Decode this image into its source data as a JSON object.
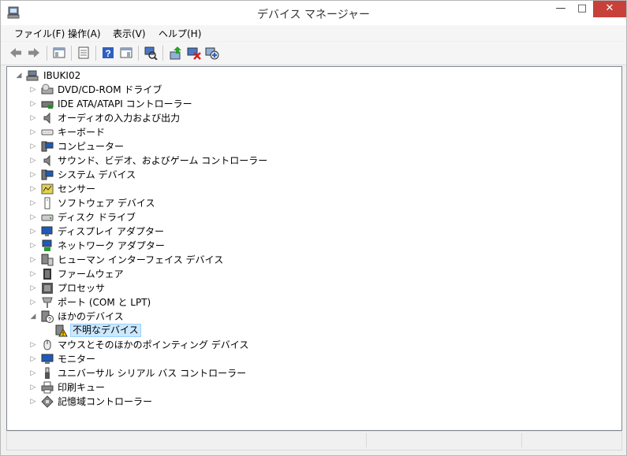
{
  "window": {
    "title": "デバイス マネージャー",
    "controls": {
      "minimize": "—",
      "maximize": "□",
      "close": "✕"
    }
  },
  "menu": [
    "ファイル(F)",
    "操作(A)",
    "表示(V)",
    "ヘルプ(H)"
  ],
  "toolbar": [
    {
      "name": "back-arrow-icon"
    },
    {
      "name": "forward-arrow-icon"
    },
    {
      "name": "show-hide-tree-icon"
    },
    {
      "name": "properties-icon"
    },
    {
      "name": "help-icon"
    },
    {
      "name": "action-pane-icon"
    },
    {
      "name": "scan-hardware-icon"
    },
    {
      "name": "update-driver-icon"
    },
    {
      "name": "uninstall-device-icon"
    },
    {
      "name": "add-legacy-hardware-icon"
    }
  ],
  "tree": {
    "root": {
      "label": "IBUKI02",
      "expanded": true
    },
    "categories": [
      {
        "label": "DVD/CD-ROM ドライブ",
        "icon": "dvd-drive-icon",
        "expanded": false
      },
      {
        "label": "IDE ATA/ATAPI コントローラー",
        "icon": "ide-controller-icon",
        "expanded": false
      },
      {
        "label": "オーディオの入力および出力",
        "icon": "speaker-icon",
        "expanded": false
      },
      {
        "label": "キーボード",
        "icon": "keyboard-icon",
        "expanded": false
      },
      {
        "label": "コンピューター",
        "icon": "computer-icon",
        "expanded": false
      },
      {
        "label": "サウンド、ビデオ、およびゲーム コントローラー",
        "icon": "sound-icon",
        "expanded": false
      },
      {
        "label": "システム デバイス",
        "icon": "system-device-icon",
        "expanded": false
      },
      {
        "label": "センサー",
        "icon": "sensor-icon",
        "expanded": false
      },
      {
        "label": "ソフトウェア デバイス",
        "icon": "software-device-icon",
        "expanded": false
      },
      {
        "label": "ディスク ドライブ",
        "icon": "disk-drive-icon",
        "expanded": false
      },
      {
        "label": "ディスプレイ アダプター",
        "icon": "display-adapter-icon",
        "expanded": false
      },
      {
        "label": "ネットワーク アダプター",
        "icon": "network-adapter-icon",
        "expanded": false
      },
      {
        "label": "ヒューマン インターフェイス デバイス",
        "icon": "hid-icon",
        "expanded": false
      },
      {
        "label": "ファームウェア",
        "icon": "firmware-icon",
        "expanded": false
      },
      {
        "label": "プロセッサ",
        "icon": "processor-icon",
        "expanded": false
      },
      {
        "label": "ポート (COM と LPT)",
        "icon": "port-icon",
        "expanded": false
      },
      {
        "label": "ほかのデバイス",
        "icon": "other-devices-icon",
        "expanded": true,
        "children": [
          {
            "label": "不明なデバイス",
            "icon": "unknown-device-warning-icon",
            "selected": true
          }
        ]
      },
      {
        "label": "マウスとそのほかのポインティング デバイス",
        "icon": "mouse-icon",
        "expanded": false
      },
      {
        "label": "モニター",
        "icon": "monitor-icon",
        "expanded": false
      },
      {
        "label": "ユニバーサル シリアル バス コントローラー",
        "icon": "usb-icon",
        "expanded": false
      },
      {
        "label": "印刷キュー",
        "icon": "printer-icon",
        "expanded": false
      },
      {
        "label": "記憶域コントローラー",
        "icon": "storage-controller-icon",
        "expanded": false
      }
    ]
  },
  "statusbar": [
    "",
    "",
    ""
  ]
}
